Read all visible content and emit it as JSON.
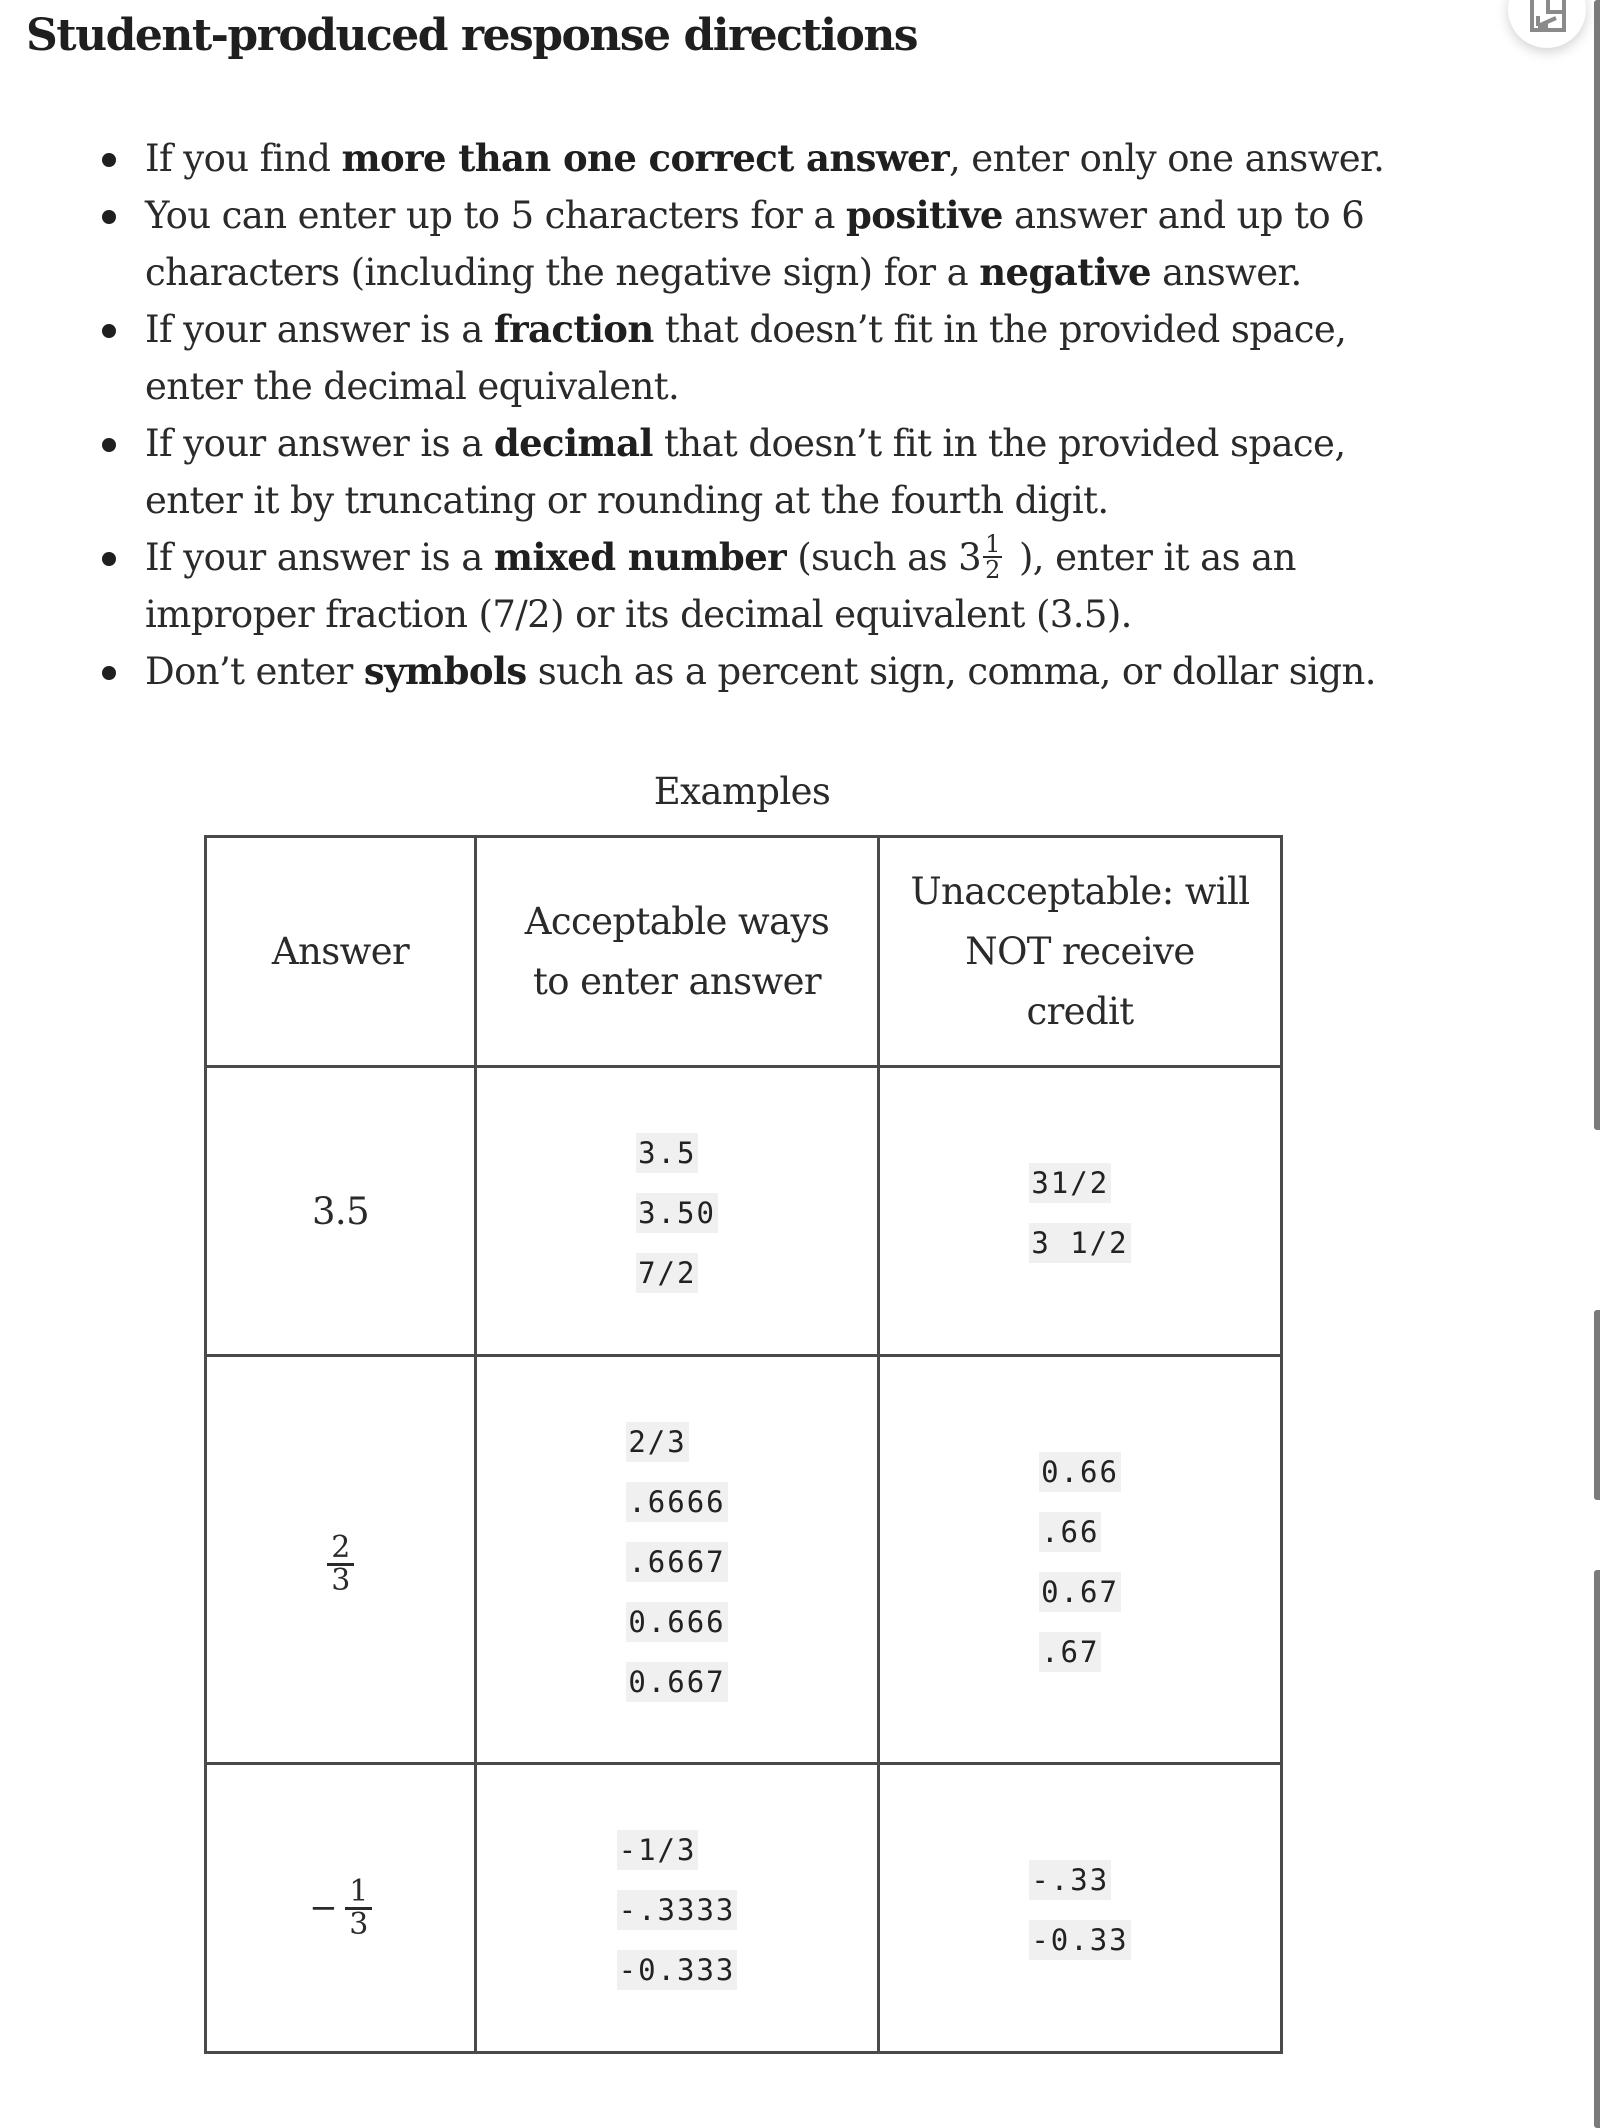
{
  "title": "Student-produced response directions",
  "bullets": [
    {
      "parts": [
        {
          "t": "If you find "
        },
        {
          "t": "more than one correct answer",
          "b": true
        },
        {
          "t": ", enter only one answer."
        }
      ]
    },
    {
      "parts": [
        {
          "t": "You can enter up to 5 characters for a "
        },
        {
          "t": "positive",
          "b": true
        },
        {
          "t": " answer and up to 6 characters (including the negative sign) for a "
        },
        {
          "t": "negative",
          "b": true
        },
        {
          "t": " answer."
        }
      ]
    },
    {
      "parts": [
        {
          "t": "If your answer is a "
        },
        {
          "t": "fraction",
          "b": true
        },
        {
          "t": " that doesn’t fit in the provided space, enter the decimal equivalent."
        }
      ]
    },
    {
      "parts": [
        {
          "t": "If your answer is a "
        },
        {
          "t": "decimal",
          "b": true
        },
        {
          "t": " that doesn’t fit in the provided space, enter it by truncating or rounding at the fourth digit."
        }
      ]
    },
    {
      "parts": [
        {
          "t": "If your answer is a "
        },
        {
          "t": "mixed number",
          "b": true
        },
        {
          "t": " (such as 3"
        },
        {
          "frac": [
            "1",
            "2"
          ]
        },
        {
          "t": "), enter it as an improper fraction (7/2) or its decimal equivalent (3.5)."
        }
      ]
    },
    {
      "parts": [
        {
          "t": "Don’t enter "
        },
        {
          "t": "symbols",
          "b": true
        },
        {
          "t": " such as a percent sign, comma, or dollar sign."
        }
      ]
    }
  ],
  "examples": {
    "caption": "Examples",
    "headers": [
      "Answer",
      "Acceptable ways to enter answer",
      "Unacceptable: will NOT receive credit"
    ],
    "rows": [
      {
        "answer": {
          "text": "3.5"
        },
        "acceptable": [
          "3.5",
          "3.50",
          "7/2"
        ],
        "unacceptable": [
          "31/2",
          "3 1/2"
        ]
      },
      {
        "answer": {
          "sign": "",
          "num": "2",
          "den": "3"
        },
        "acceptable": [
          "2/3",
          ".6666",
          ".6667",
          "0.666",
          "0.667"
        ],
        "unacceptable": [
          "0.66",
          ".66",
          "0.67",
          ".67"
        ]
      },
      {
        "answer": {
          "sign": "−",
          "num": "1",
          "den": "3"
        },
        "acceptable": [
          "-1/3",
          "-.3333",
          "-0.333"
        ],
        "unacceptable": [
          "-.33",
          "-0.33"
        ]
      }
    ]
  },
  "icons": {
    "popout": "popout-window-icon"
  },
  "colors": {
    "text": "#222222",
    "border": "#4a4a4a",
    "code_bg": "#f0f0f0",
    "scrollbar": "#7a7a7a"
  }
}
